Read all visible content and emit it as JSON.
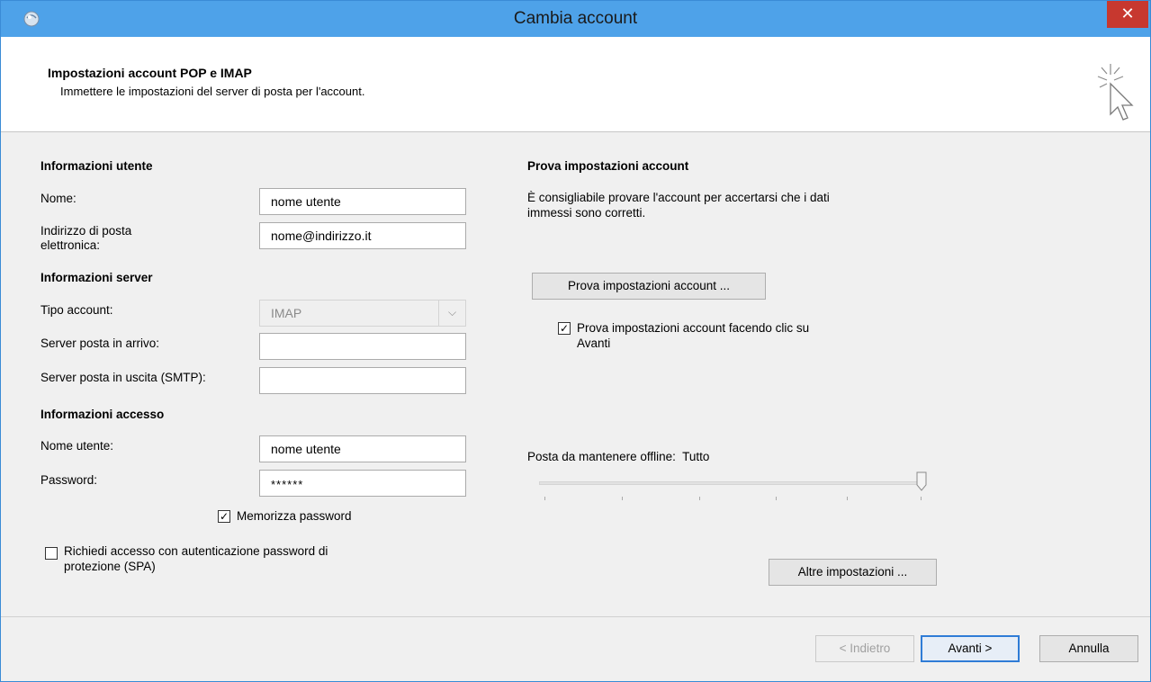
{
  "window": {
    "title": "Cambia account",
    "close_label": "✕"
  },
  "header": {
    "title": "Impostazioni account POP e IMAP",
    "subtitle": "Immettere le impostazioni del server di posta per l'account."
  },
  "user_info": {
    "section_title": "Informazioni utente",
    "name_label": "Nome:",
    "name_value": "nome utente",
    "email_label_line1": "Indirizzo di posta",
    "email_label_line2": "elettronica:",
    "email_value": "nome@indirizzo.it"
  },
  "server_info": {
    "section_title": "Informazioni server",
    "account_type_label": "Tipo account:",
    "account_type_value": "IMAP",
    "incoming_label": "Server posta in arrivo:",
    "incoming_value": "",
    "outgoing_label": "Server posta in uscita (SMTP):",
    "outgoing_value": ""
  },
  "login_info": {
    "section_title": "Informazioni accesso",
    "username_label": "Nome utente:",
    "username_value": "nome utente",
    "password_label": "Password:",
    "password_value": "******",
    "remember_password_label": "Memorizza password",
    "remember_password_checked": true,
    "spa_label_line1": "Richiedi accesso con autenticazione password di",
    "spa_label_line2": "protezione (SPA)",
    "spa_checked": false
  },
  "test_settings": {
    "section_title": "Prova impostazioni account",
    "description_line1": "È consigliabile provare l'account per accertarsi che i dati",
    "description_line2": "immessi sono corretti.",
    "test_button_label": "Prova impostazioni account ...",
    "auto_test_label_line1": "Prova impostazioni account facendo clic su",
    "auto_test_label_line2": "Avanti",
    "auto_test_checked": true
  },
  "offline": {
    "label": "Posta da mantenere offline:",
    "value": "Tutto",
    "slider_level": 1.0
  },
  "more_settings_label": "Altre impostazioni ...",
  "footer": {
    "back_label": "< Indietro",
    "next_label": "Avanti >",
    "cancel_label": "Annulla"
  },
  "colors": {
    "titlebar": "#4ea2e9",
    "close": "#c7382f",
    "dialog_bg": "#f0f0f0",
    "default_button_border": "#2f7cd6"
  }
}
